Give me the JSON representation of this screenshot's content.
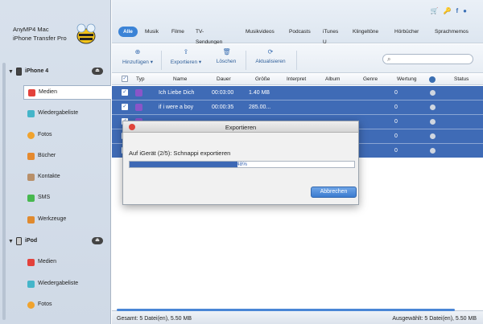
{
  "app": {
    "title_line1": "AnyMP4 Mac",
    "title_line2": "iPhone Transfer Pro"
  },
  "sidebar": {
    "devices": [
      {
        "label": "iPhone 4",
        "items": [
          {
            "label": "Medien",
            "color": "#e3413b"
          },
          {
            "label": "Wiedergabeliste",
            "color": "#45b5c9"
          },
          {
            "label": "Fotos",
            "color": "#f0a32e"
          },
          {
            "label": "Bücher",
            "color": "#e58a2f"
          },
          {
            "label": "Kontakte",
            "color": "#b8906a"
          },
          {
            "label": "SMS",
            "color": "#47b84f"
          },
          {
            "label": "Werkzeuge",
            "color": "#e08a2e"
          }
        ]
      },
      {
        "label": "iPod",
        "items": [
          {
            "label": "Medien",
            "color": "#e3413b"
          },
          {
            "label": "Wiedergabeliste",
            "color": "#45b5c9"
          },
          {
            "label": "Fotos",
            "color": "#f0a32e"
          }
        ]
      }
    ]
  },
  "tabs": [
    "Alle",
    "Musik",
    "Filme",
    "TV-Sendungen",
    "Musikvideos",
    "Podcasts",
    "iTunes U",
    "Klingeltöne",
    "Hörbücher",
    "Sprachmemos"
  ],
  "toolbar": {
    "add": "Hinzufügen",
    "export": "Exportieren",
    "delete": "Löschen",
    "refresh": "Aktualisieren"
  },
  "table": {
    "headers": [
      "Typ",
      "Name",
      "Dauer",
      "Größe",
      "Interpret",
      "Album",
      "Genre",
      "Wertung",
      "Status"
    ],
    "rows": [
      {
        "name": "Ich Liebe Dich",
        "duration": "00:03:00",
        "size": "1.40 MB",
        "rating": "0"
      },
      {
        "name": "if i were a boy",
        "duration": "00:00:35",
        "size": "285.00...",
        "rating": "0"
      },
      {
        "name": "",
        "duration": "",
        "size": "",
        "rating": "0"
      },
      {
        "name": "",
        "duration": "",
        "size": "",
        "rating": "0"
      },
      {
        "name": "",
        "duration": "",
        "size": "",
        "rating": "0"
      }
    ]
  },
  "status": {
    "total": "Gesamt: 5 Datei(en), 5.50 MB",
    "selected": "Ausgewählt: 5 Datei(en), 5.50 MB"
  },
  "dialog": {
    "title": "Exportieren",
    "message": "Auf iGerät (2/5): Schnappi exportieren",
    "progress_percent": 48,
    "progress_label": "48%",
    "cancel": "Abbrechen"
  }
}
